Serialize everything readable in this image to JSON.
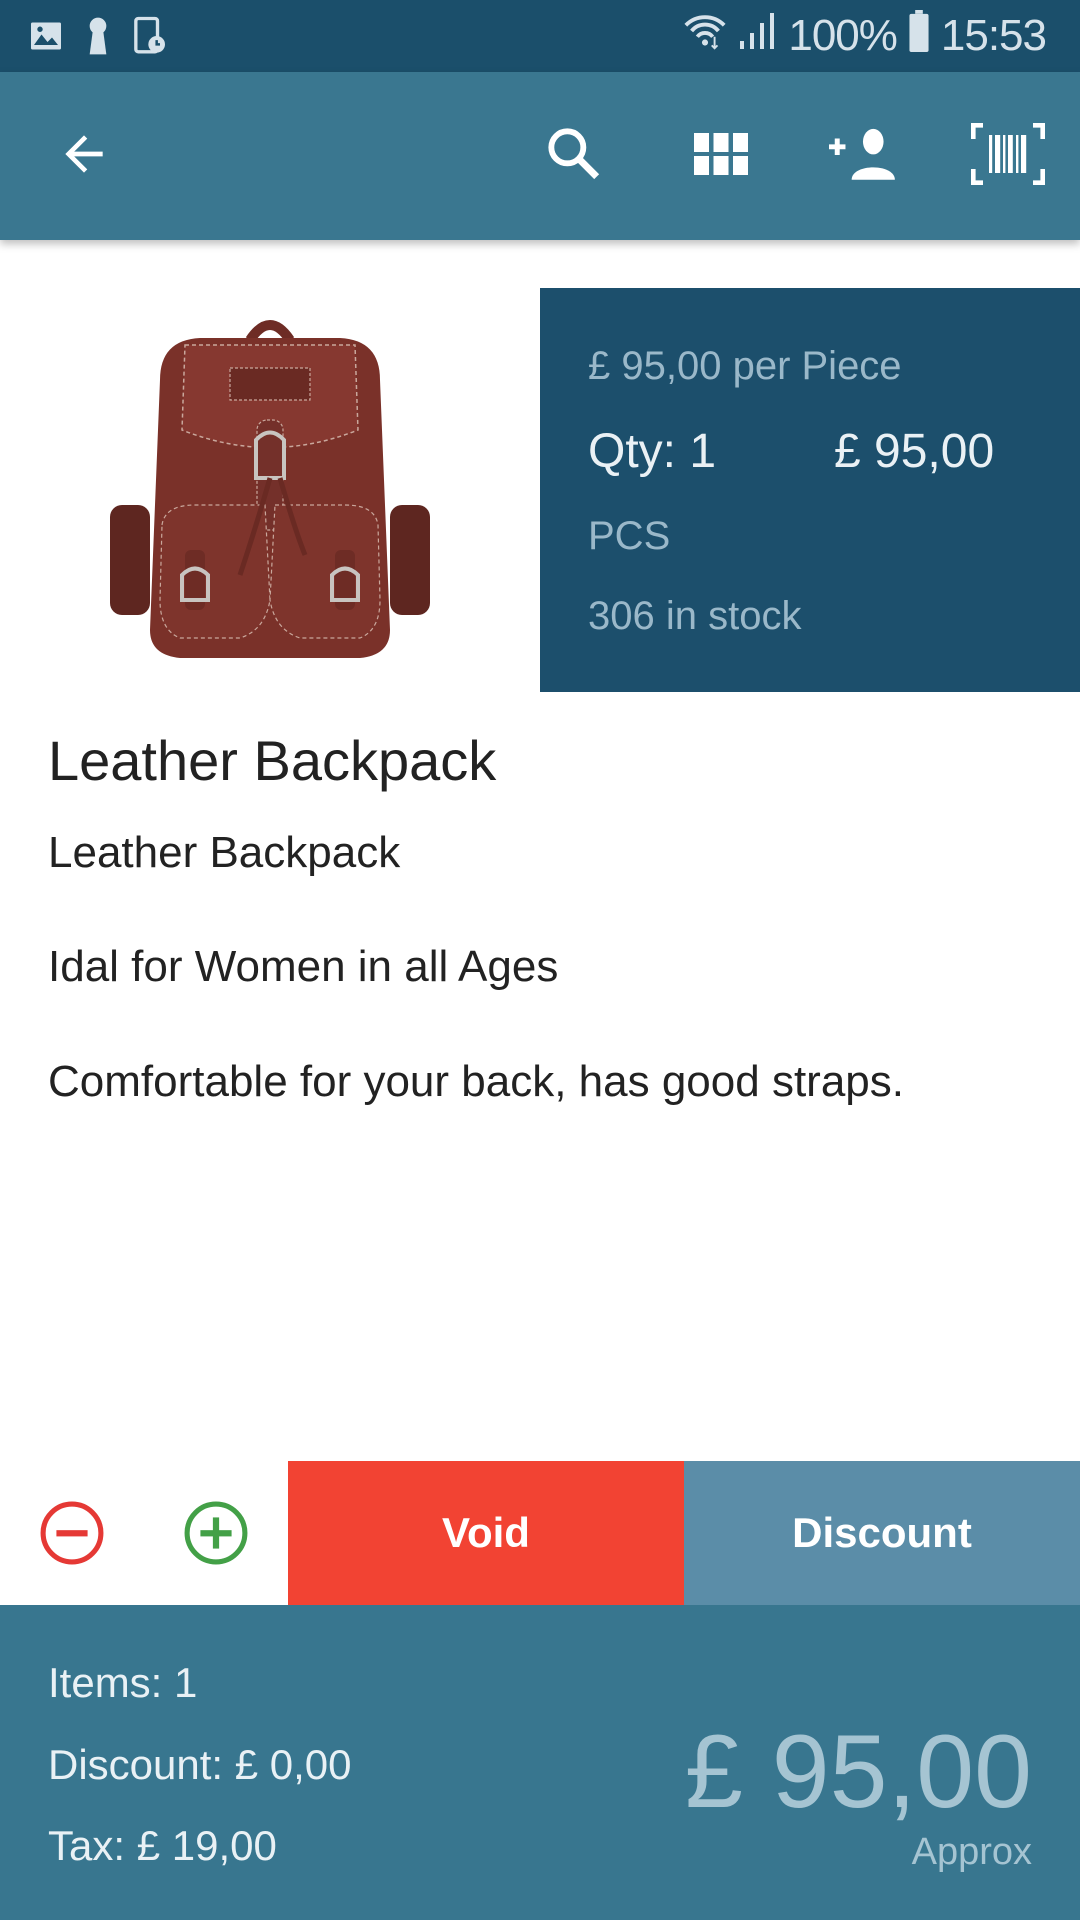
{
  "status_bar": {
    "left_icons": [
      "gallery-icon",
      "keyhole-icon",
      "screen-timer-icon"
    ],
    "right_icons": [
      "wifi-icon",
      "signal-icon"
    ],
    "battery_percent": "100%",
    "battery_icon": "battery-icon",
    "time": "15:53"
  },
  "toolbar": {
    "back_icon": "arrow-back-icon",
    "actions": [
      {
        "name": "search",
        "icon": "search-icon"
      },
      {
        "name": "grid",
        "icon": "grid-icon"
      },
      {
        "name": "add-customer",
        "icon": "person-add-icon"
      },
      {
        "name": "scan-barcode",
        "icon": "barcode-scan-icon"
      }
    ]
  },
  "product": {
    "image_alt": "Leather Backpack product image",
    "price_per_unit": "£ 95,00 per Piece",
    "qty": "Qty: 1",
    "line_total": "£ 95,00",
    "unit": "PCS",
    "stock": "306 in stock",
    "title": "Leather Backpack",
    "description": [
      "Leather Backpack",
      "Idal for Women in all Ages",
      "Comfortable for your back, has good straps."
    ]
  },
  "actions": {
    "decrease_icon": "minus-circle-icon",
    "increase_icon": "plus-circle-icon",
    "void_label": "Void",
    "discount_label": "Discount"
  },
  "footer": {
    "items": "Items: 1",
    "discount": "Discount: £ 0,00",
    "tax": "Tax: £ 19,00",
    "total": "£ 95,00",
    "approx": "Approx"
  },
  "colors": {
    "status_bar": "#1b4f6b",
    "toolbar": "#3a7790",
    "info_panel": "#1c4f6c",
    "void": "#f24333",
    "discount": "#5b8da8",
    "footer": "#38768f",
    "minus": "#e53935",
    "plus": "#43a047"
  }
}
